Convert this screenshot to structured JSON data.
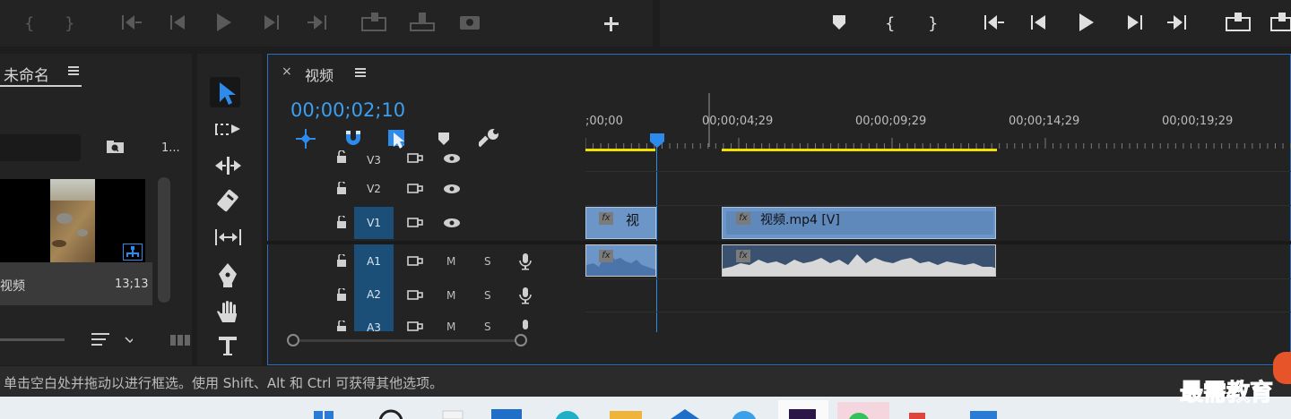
{
  "project": {
    "tab_title": "未命名",
    "item_name": "视频",
    "item_duration": "13;13",
    "item_count": "1..."
  },
  "timeline": {
    "tab_title": "视频",
    "close_glyph": "×",
    "timecode": "00;00;02;10",
    "ruler": [
      ";00;00",
      "00;00;04;29",
      "00;00;09;29",
      "00;00;14;29",
      "00;00;19;29"
    ],
    "tracks": {
      "v3": "V3",
      "v2": "V2",
      "v1": "V1",
      "a1": "A1",
      "a2": "A2",
      "a3": "A3"
    },
    "mute_label": "M",
    "solo_label": "S",
    "clip_v1_short": "视",
    "clip_v1_long": "视频.mp4 [V]",
    "fx_label": "fx"
  },
  "status": {
    "hint": "单击空白处并拖动以进行框选。使用 Shift、Alt 和 Ctrl 可获得其他选项。"
  },
  "watermark": "最需教育",
  "colors": {
    "accent": "#2d8ceb",
    "timecode": "#3b9ff0",
    "clip_video": "#6d96c8",
    "clip_audio": "#3b5170",
    "work_area": "#f0e000"
  }
}
